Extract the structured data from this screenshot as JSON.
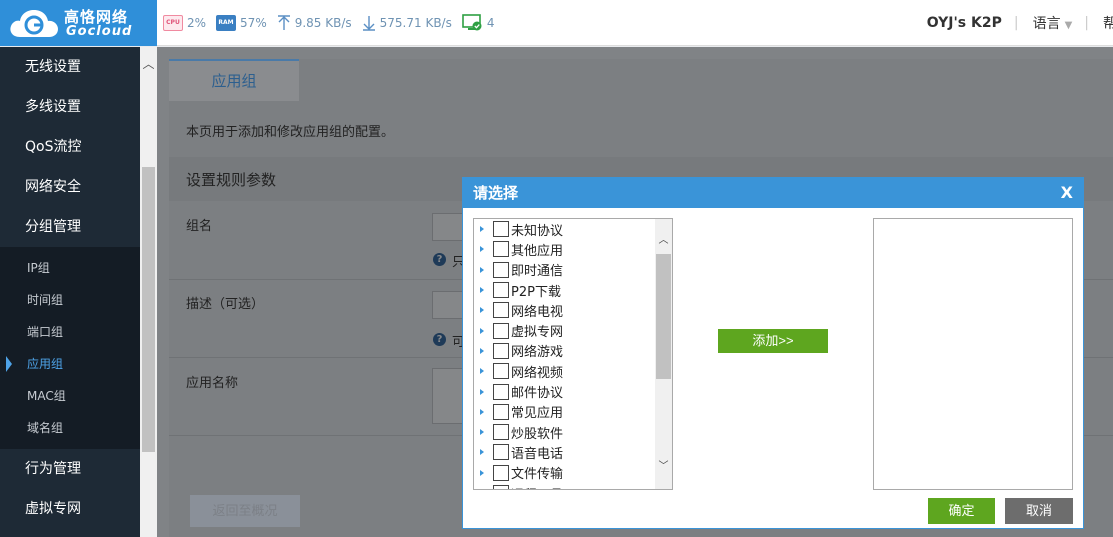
{
  "brand": {
    "name_cn": "高恪网络",
    "name_en": "Gocloud",
    "logo_icon": "cloud-logo-icon",
    "color": "#2f8fd9"
  },
  "status": {
    "cpu_label": "CPU",
    "cpu": "2%",
    "ram_label": "RAM",
    "ram": "57%",
    "upload": "9.85 KB/s",
    "download": "575.71 KB/s",
    "devices": "4"
  },
  "header": {
    "router_name": "OYJ's K2P",
    "language": "语言",
    "truncated": "帮"
  },
  "sidebar": {
    "items_top": [
      "无线设置",
      "多线设置",
      "QoS流控",
      "网络安全",
      "分组管理"
    ],
    "sub_items": [
      "IP组",
      "时间组",
      "端口组",
      "应用组",
      "MAC组",
      "域名组"
    ],
    "active_sub": 3,
    "items_bottom": [
      "行为管理",
      "虚拟专网"
    ]
  },
  "main": {
    "tab": "应用组",
    "description": "本页用于添加和修改应用组的配置。",
    "section_title": "设置规则参数",
    "field_group_name": "组名",
    "help_group_name": "只",
    "field_desc": "描述（可选）",
    "help_desc": "可",
    "field_app_name": "应用名称",
    "back_button": "返回至概况"
  },
  "modal": {
    "title": "请选择",
    "close": "X",
    "tree_items": [
      "未知协议",
      "其他应用",
      "即时通信",
      "P2P下载",
      "网络电视",
      "虚拟专网",
      "网络游戏",
      "网络视频",
      "邮件协议",
      "常见应用",
      "炒股软件",
      "语音电话",
      "文件传输",
      "远程工具"
    ],
    "add_button": "添加>>",
    "ok_button": "确定",
    "cancel_button": "取消",
    "accent": "#3a94d8",
    "green": "#5ea61f"
  }
}
